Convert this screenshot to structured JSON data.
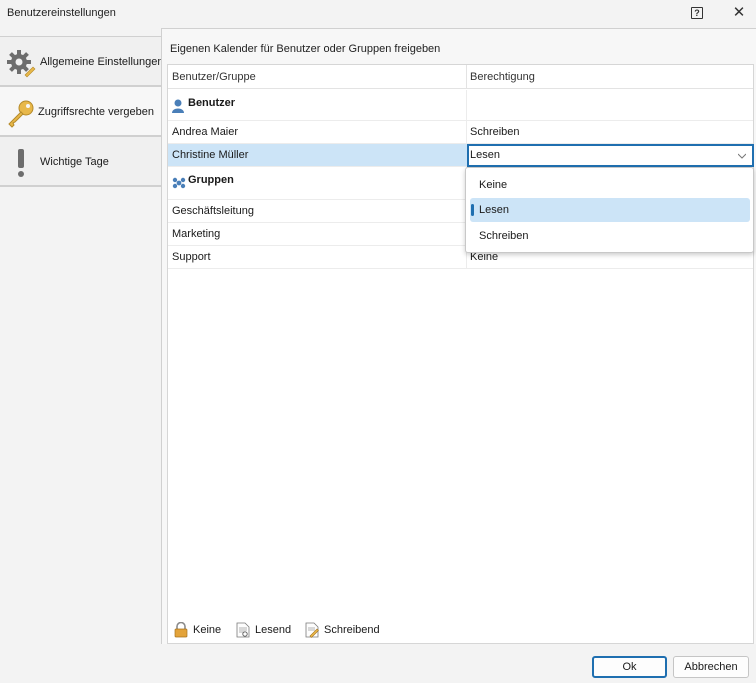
{
  "window": {
    "title": "Benutzereinstellungen",
    "help_label": "?",
    "close_label": "✕"
  },
  "sidebar": {
    "items": [
      {
        "label": "Allgemeine Einstellungen",
        "icon": "gear-icon"
      },
      {
        "label": "Zugriffsrechte vergeben",
        "icon": "key-icon"
      },
      {
        "label": "Wichtige Tage",
        "icon": "exclamation-icon"
      }
    ]
  },
  "panel": {
    "heading": "Eigenen Kalender für Benutzer oder Gruppen freigeben",
    "columns": {
      "user": "Benutzer/Gruppe",
      "permission": "Berechtigung"
    },
    "users_group": {
      "label": "Benutzer",
      "icon": "user-icon"
    },
    "groups_group": {
      "label": "Gruppen",
      "icon": "group-icon"
    },
    "users": [
      {
        "name": "Andrea Maier",
        "permission": "Schreiben"
      },
      {
        "name": "Christine Müller",
        "permission": "Lesen"
      }
    ],
    "groups": [
      {
        "name": "Geschäftsleitung",
        "permission": ""
      },
      {
        "name": "Marketing",
        "permission": ""
      },
      {
        "name": "Support",
        "permission": "Keine"
      }
    ],
    "dropdown": {
      "options": [
        "Keine",
        "Lesen",
        "Schreiben"
      ],
      "selected": "Lesen"
    },
    "legend": [
      {
        "label": "Keine",
        "icon": "lock-icon"
      },
      {
        "label": "Lesend",
        "icon": "read-document-icon"
      },
      {
        "label": "Schreibend",
        "icon": "write-document-icon"
      }
    ]
  },
  "footer": {
    "ok_label": "Ok",
    "cancel_label": "Abbrechen"
  },
  "colors": {
    "accent": "#1f6fb0",
    "selection": "#cce4f7"
  }
}
